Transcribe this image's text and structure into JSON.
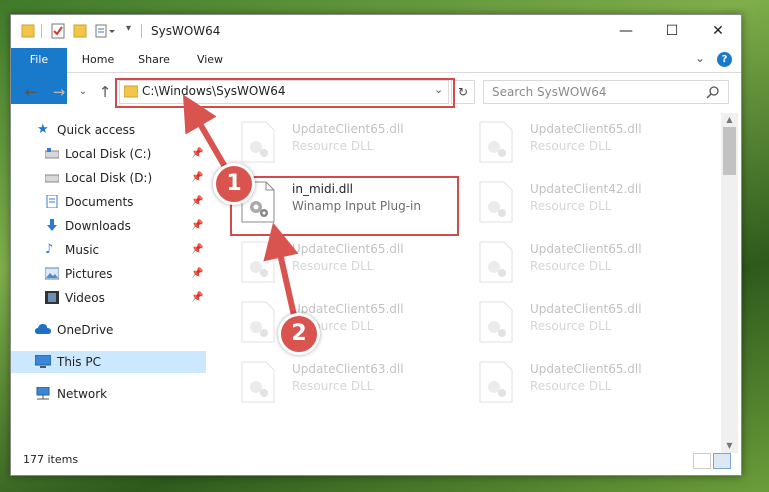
{
  "window": {
    "title": "SysWOW64"
  },
  "window_controls": {
    "minimize": "—",
    "maximize": "☐",
    "close": "✕"
  },
  "ribbon": {
    "tabs": [
      "File",
      "Home",
      "Share",
      "View"
    ],
    "expand": "⌄",
    "help": "?"
  },
  "address": {
    "path": "C:\\Windows\\SysWOW64",
    "dropdown": "⌄",
    "refresh": "↻"
  },
  "search": {
    "placeholder": "Search SysWOW64",
    "icon": "🔍"
  },
  "nav": {
    "back": "←",
    "forward": "→",
    "recent": "⌄",
    "up": "↑"
  },
  "sidebar": {
    "items": [
      {
        "label": "Quick access",
        "icon": "star-icon"
      },
      {
        "label": "Local Disk (C:)",
        "icon": "drive-icon",
        "pinned": true
      },
      {
        "label": "Local Disk (D:)",
        "icon": "drive-icon",
        "pinned": true
      },
      {
        "label": "Documents",
        "icon": "documents-icon",
        "pinned": true
      },
      {
        "label": "Downloads",
        "icon": "downloads-icon",
        "pinned": true
      },
      {
        "label": "Music",
        "icon": "music-icon",
        "pinned": true
      },
      {
        "label": "Pictures",
        "icon": "pictures-icon",
        "pinned": true
      },
      {
        "label": "Videos",
        "icon": "videos-icon",
        "pinned": true
      },
      {
        "label": "OneDrive",
        "icon": "cloud-icon"
      },
      {
        "label": "This PC",
        "icon": "computer-icon",
        "selected": true
      },
      {
        "label": "Network",
        "icon": "network-icon"
      }
    ],
    "pin_glyph": "📌"
  },
  "files": [
    {
      "name": "UpdateClient65.dll",
      "desc": "Resource DLL"
    },
    {
      "name": "UpdateClient65.dll",
      "desc": "Resource DLL"
    },
    {
      "name": "in_midi.dll",
      "desc": "Winamp Input Plug-in",
      "highlighted": true
    },
    {
      "name": "UpdateClient42.dll",
      "desc": "Resource DLL"
    },
    {
      "name": "UpdateClient65.dll",
      "desc": "Resource DLL"
    },
    {
      "name": "UpdateClient65.dll",
      "desc": "Resource DLL"
    },
    {
      "name": "UpdateClient65.dll",
      "desc": "Resource DLL"
    },
    {
      "name": "UpdateClient65.dll",
      "desc": "Resource DLL"
    },
    {
      "name": "UpdateClient63.dll",
      "desc": "Resource DLL"
    },
    {
      "name": "UpdateClient65.dll",
      "desc": "Resource DLL"
    }
  ],
  "status": {
    "item_count": "177 items"
  },
  "callouts": [
    "1",
    "2"
  ],
  "colors": {
    "accent": "#1979ca",
    "highlight": "#d24b4b",
    "selected_bg": "#cce8ff"
  }
}
